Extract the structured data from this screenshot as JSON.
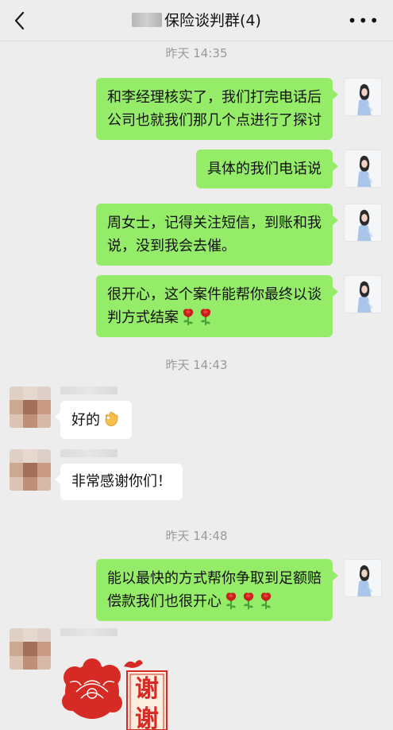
{
  "header": {
    "title": "保险谈判群(4)",
    "more": "•••"
  },
  "times": [
    "昨天 14:35",
    "昨天 14:43",
    "昨天 14:48"
  ],
  "messages": {
    "m1": [
      "和李经理核实了，我们打完电话后",
      "公司也就我们那几个点进行了探讨"
    ],
    "m2": [
      "具体的我们电话说"
    ],
    "m3": [
      "周女士，记得关注短信，到账和我",
      "说，没到我会去催。"
    ],
    "m4": [
      "很开心，这个案件能帮你最终以谈",
      "判方式结案"
    ],
    "m5": "好的",
    "m6": "非常感谢你们！",
    "m7": [
      "能以最快的方式帮你争取到足额赔",
      "偿款我们也很开心"
    ]
  },
  "sticker": {
    "char1": "谢",
    "char2": "谢"
  },
  "icons": {
    "back": "chevron-left-icon",
    "more": "more-dots-icon",
    "rose": "rose-emoji",
    "ok": "ok-hand-emoji"
  },
  "colors": {
    "bubble_out": "#95ec69",
    "bubble_in": "#ffffff",
    "background": "#ededed",
    "sticker_red": "#d62a25"
  }
}
